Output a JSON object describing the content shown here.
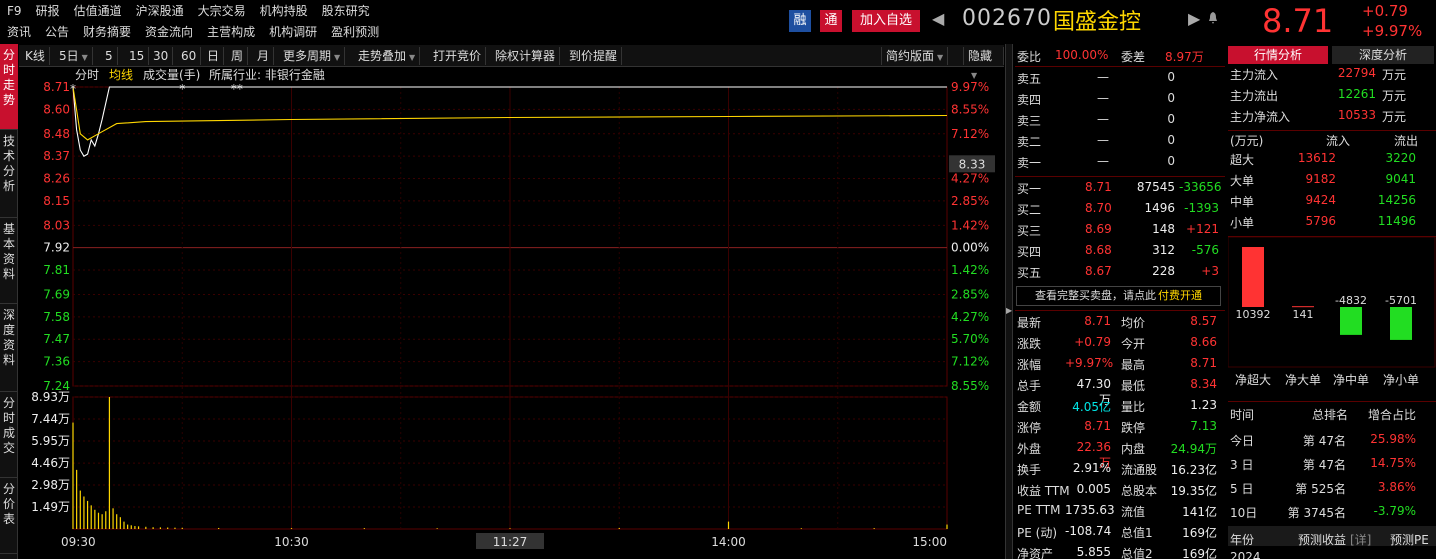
{
  "header": {
    "menu_row1": [
      "F9",
      "研报",
      "估值通道",
      "沪深股通",
      "大宗交易",
      "机构持股",
      "股东研究"
    ],
    "menu_row2": [
      "资讯",
      "公告",
      "财务摘要",
      "资金流向",
      "主营构成",
      "机构调研",
      "盈利预测"
    ],
    "badge_rong": "融",
    "badge_tong": "通",
    "add_watch": "加入自选",
    "stock_code": "002670",
    "stock_name": "国盛金控",
    "price": "8.71",
    "change": "+0.79",
    "change_pct": "+9.97%",
    "prev_arrow": "◀",
    "next_arrow": "▶"
  },
  "left_nav": [
    "分时走势",
    "技术分析",
    "基本资料",
    "深度资料",
    "分时成交",
    "分价表"
  ],
  "toolbar": {
    "items": [
      "K线",
      "5日",
      "5",
      "15",
      "30",
      "60",
      "日",
      "周",
      "月",
      "更多周期",
      "走势叠加",
      "打开竞价",
      "除权计算器",
      "到价提醒"
    ],
    "right_items": [
      "简约版面",
      "隐藏"
    ]
  },
  "chart": {
    "legend": [
      "分时",
      "均线",
      "成交量(手)",
      "所属行业: 非银行金融"
    ],
    "current_label": "8.33",
    "price_ticks": [
      "8.71",
      "8.60",
      "8.48",
      "8.37",
      "8.26",
      "8.15",
      "8.03",
      "7.92",
      "7.81",
      "7.69",
      "7.58",
      "7.47",
      "7.36",
      "7.24"
    ],
    "pct_ticks": [
      "9.97%",
      "8.55%",
      "7.12%",
      "",
      "4.27%",
      "2.85%",
      "1.42%",
      "0.00%",
      "1.42%",
      "2.85%",
      "4.27%",
      "5.70%",
      "7.12%",
      "8.55%"
    ],
    "vol_ticks": [
      "8.93万",
      "7.44万",
      "5.95万",
      "4.46万",
      "2.98万",
      "1.49万"
    ],
    "time_ticks": [
      "09:30",
      "10:30",
      "11:27",
      "14:00",
      "15:00"
    ]
  },
  "chart_data": {
    "type": "line",
    "title": "",
    "ylim": [
      7.24,
      8.71
    ],
    "series": [
      {
        "name": "分时",
        "x": [
          0,
          1,
          2,
          3,
          4,
          5,
          6,
          7,
          8,
          10,
          12,
          14,
          20,
          40,
          240
        ],
        "values": [
          8.71,
          8.5,
          8.4,
          8.37,
          8.38,
          8.45,
          8.42,
          8.48,
          8.55,
          8.71,
          8.71,
          8.71,
          8.71,
          8.71,
          8.71
        ]
      },
      {
        "name": "均线",
        "x": [
          0,
          2,
          4,
          6,
          8,
          12,
          20,
          60,
          120,
          180,
          240
        ],
        "values": [
          8.71,
          8.48,
          8.45,
          8.47,
          8.49,
          8.53,
          8.54,
          8.55,
          8.56,
          8.565,
          8.57
        ]
      }
    ],
    "volume": {
      "name": "成交量(手)",
      "ylim": [
        0,
        89300
      ],
      "x": [
        0,
        1,
        2,
        3,
        4,
        5,
        6,
        7,
        8,
        9,
        10,
        11,
        12,
        13,
        14,
        15,
        16,
        17,
        18,
        20,
        22,
        24,
        26,
        28,
        30,
        40,
        60,
        80,
        100,
        120,
        150,
        180,
        200,
        220,
        240
      ],
      "values": [
        72000,
        40000,
        26000,
        22000,
        19000,
        16000,
        13000,
        11000,
        10000,
        12000,
        89300,
        14000,
        10000,
        8000,
        5000,
        3000,
        2500,
        2000,
        1800,
        1500,
        1200,
        1100,
        1000,
        900,
        800,
        700,
        600,
        600,
        500,
        500,
        700,
        5000,
        500,
        600,
        3000
      ]
    }
  },
  "orderbook": {
    "wei_bi_label": "委比",
    "wei_bi": "100.00%",
    "wei_cha_label": "委差",
    "wei_cha": "8.97万",
    "asks": [
      [
        "卖五",
        "—",
        "0"
      ],
      [
        "卖四",
        "—",
        "0"
      ],
      [
        "卖三",
        "—",
        "0"
      ],
      [
        "卖二",
        "—",
        "0"
      ],
      [
        "卖一",
        "—",
        "0"
      ]
    ],
    "bids": [
      [
        "买一",
        "8.71",
        "87545",
        "-33656"
      ],
      [
        "买二",
        "8.70",
        "1496",
        "-1393"
      ],
      [
        "买三",
        "8.69",
        "148",
        "+121"
      ],
      [
        "买四",
        "8.68",
        "312",
        "-576"
      ],
      [
        "买五",
        "8.67",
        "228",
        "+3"
      ]
    ],
    "full_book_notice": "查看完整买卖盘，请点此",
    "pay_link": "付费开通",
    "stats": [
      [
        "最新",
        "8.71",
        "均价",
        "8.57"
      ],
      [
        "涨跌",
        "+0.79",
        "今开",
        "8.66"
      ],
      [
        "涨幅",
        "+9.97%",
        "最高",
        "8.71"
      ],
      [
        "总手",
        "47.30万",
        "最低",
        "8.34"
      ],
      [
        "金额",
        "4.05亿",
        "量比",
        "1.23"
      ],
      [
        "涨停",
        "8.71",
        "跌停",
        "7.13"
      ],
      [
        "外盘",
        "22.36万",
        "内盘",
        "24.94万"
      ],
      [
        "换手",
        "2.91%",
        "流通股",
        "16.23亿"
      ],
      [
        "收益 TTM",
        "0.005",
        "总股本",
        "19.35亿"
      ],
      [
        "PE TTM",
        "1735.63",
        "流值",
        "141亿"
      ],
      [
        "PE (动)",
        "-108.74",
        "总值1",
        "169亿"
      ],
      [
        "净资产",
        "5.855",
        "总值2",
        "169亿"
      ]
    ]
  },
  "analysis": {
    "tabs": [
      "行情分析",
      "深度分析"
    ],
    "main_flow": [
      [
        "主力流入",
        "22794",
        "万元"
      ],
      [
        "主力流出",
        "12261",
        "万元"
      ],
      [
        "主力净流入",
        "10533",
        "万元"
      ]
    ],
    "table_head": [
      "(万元)",
      "流入",
      "流出"
    ],
    "table": [
      [
        "超大",
        "13612",
        "3220"
      ],
      [
        "大单",
        "9182",
        "9041"
      ],
      [
        "中单",
        "9424",
        "14256"
      ],
      [
        "小单",
        "5796",
        "11496"
      ]
    ],
    "bars": {
      "labels": [
        "净超大",
        "净大单",
        "净中单",
        "净小单"
      ],
      "values": [
        10392,
        141,
        -4832,
        -5701
      ],
      "value_labels": [
        "10392",
        "141",
        "-4832",
        "-5701"
      ]
    },
    "rank_head": [
      "时间",
      "总排名",
      "增合占比"
    ],
    "rank": [
      [
        "今日",
        "第 47名",
        "25.98%"
      ],
      [
        "3 日",
        "第 47名",
        "14.75%"
      ],
      [
        "5 日",
        "第 525名",
        "3.86%"
      ],
      [
        "10日",
        "第 3745名",
        "-3.79%"
      ]
    ],
    "forecast_head": [
      "年份",
      "预测收益",
      "[详]",
      "预测PE"
    ],
    "forecast_year": "2024"
  },
  "colors": {
    "up": "#ff3333",
    "down": "#22dd22",
    "accent": "#c8102e",
    "yellow": "#ffd700"
  }
}
